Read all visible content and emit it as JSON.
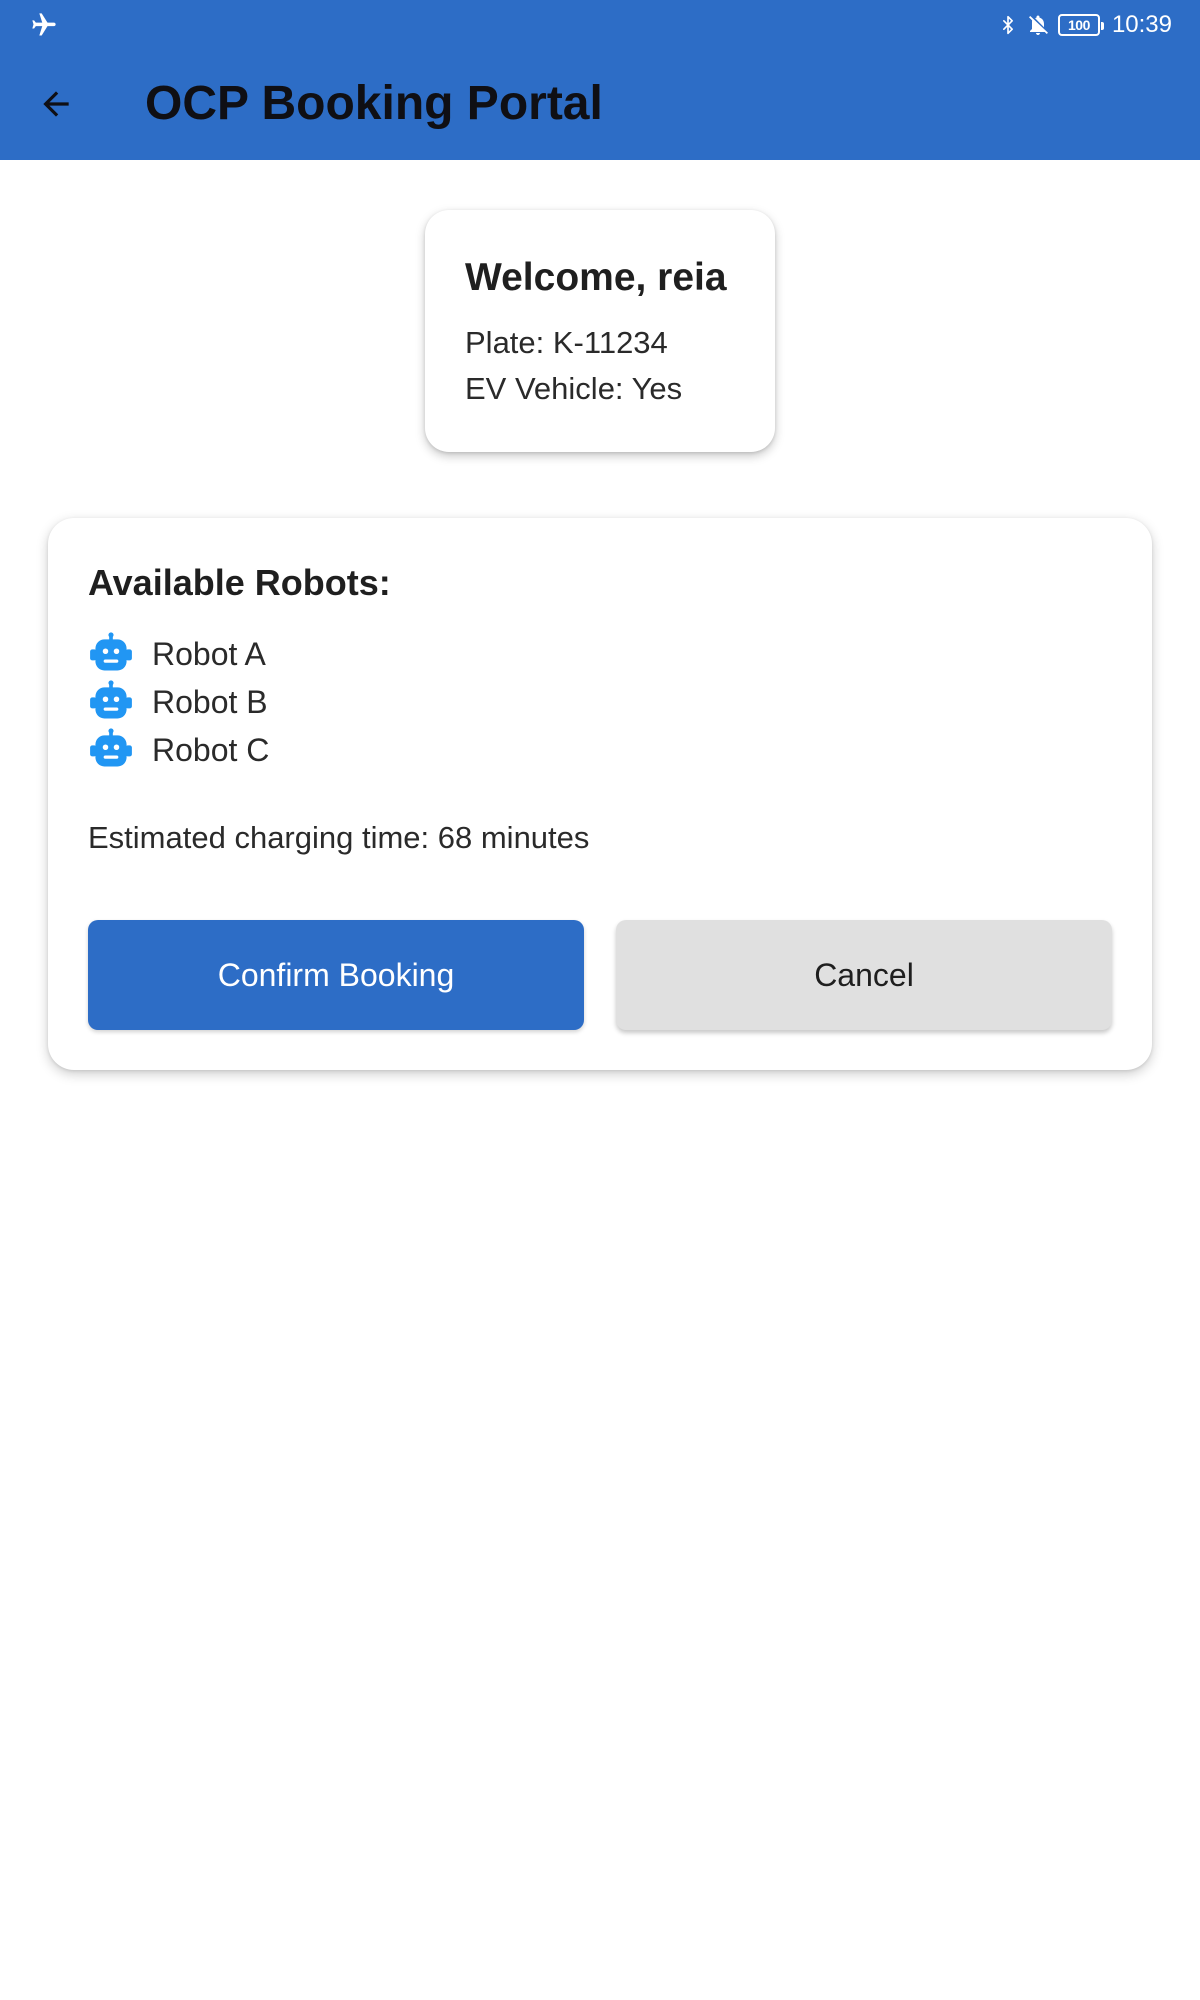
{
  "status_bar": {
    "time": "10:39",
    "battery_level": "100",
    "icons": [
      "airplane-mode-icon",
      "bluetooth-icon",
      "notifications-off-icon",
      "battery-icon"
    ]
  },
  "header": {
    "title": "OCP Booking Portal",
    "back_icon": "arrow-back-icon"
  },
  "welcome_card": {
    "greeting": "Welcome, reia",
    "plate": "Plate: K-11234",
    "ev_vehicle": "EV Vehicle: Yes"
  },
  "robots_card": {
    "heading": "Available Robots:",
    "robots": [
      {
        "label": "Robot A",
        "icon": "robot-icon"
      },
      {
        "label": "Robot B",
        "icon": "robot-icon"
      },
      {
        "label": "Robot C",
        "icon": "robot-icon"
      }
    ],
    "estimate": "Estimated charging time: 68 minutes",
    "confirm_label": "Confirm Booking",
    "cancel_label": "Cancel"
  },
  "colors": {
    "primary": "#2d6dc6",
    "robot_icon": "#2196f3",
    "cancel_bg": "#e0e0e0",
    "background": "#ffffff"
  }
}
